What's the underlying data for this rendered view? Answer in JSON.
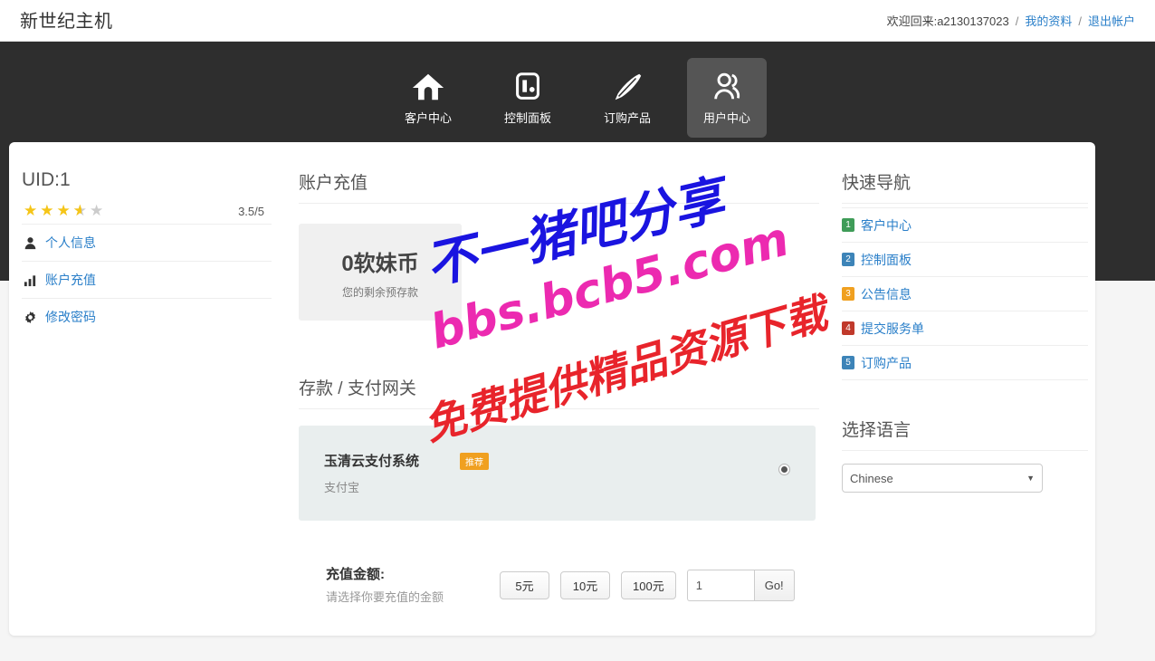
{
  "header": {
    "brand": "新世纪主机",
    "welcome_prefix": "欢迎回来:",
    "username": "a2130137023",
    "sep": "/",
    "profile_link": "我的资料",
    "logout_link": "退出帐户"
  },
  "nav": {
    "items": [
      {
        "label": "客户中心",
        "icon": "home-icon",
        "active": false
      },
      {
        "label": "控制面板",
        "icon": "control-panel-icon",
        "active": false
      },
      {
        "label": "订购产品",
        "icon": "quill-pen-icon",
        "active": false
      },
      {
        "label": "用户中心",
        "icon": "users-icon",
        "active": true
      }
    ]
  },
  "sidebar": {
    "uid": "UID:1",
    "rating_value": "3.5/5",
    "rating_stars": 3.5,
    "links": [
      {
        "label": "个人信息",
        "icon": "user-icon"
      },
      {
        "label": "账户充值",
        "icon": "bar-chart-icon"
      },
      {
        "label": "修改密码",
        "icon": "gear-icon"
      }
    ]
  },
  "main": {
    "title": "账户充值",
    "balance": {
      "amount": "0软妹币",
      "caption": "您的剩余预存款"
    },
    "gateway_title": "存款 / 支付网关",
    "gateway": {
      "name": "玉清云支付系统",
      "badge": "推荐",
      "sub": "支付宝",
      "selected": true
    },
    "amount": {
      "label": "充值金额:",
      "hint": "请选择你要充值的金额",
      "presets": [
        "5元",
        "10元",
        "100元"
      ],
      "custom_value": "1",
      "go_label": "Go!"
    }
  },
  "right": {
    "quick_nav_title": "快速导航",
    "quick_items": [
      {
        "num": "1",
        "label": "客户中心",
        "color": "#3f9c58"
      },
      {
        "num": "2",
        "label": "控制面板",
        "color": "#3d84b8"
      },
      {
        "num": "3",
        "label": "公告信息",
        "color": "#f0a020"
      },
      {
        "num": "4",
        "label": "提交服务单",
        "color": "#c0392b"
      },
      {
        "num": "5",
        "label": "订购产品",
        "color": "#3d84b8"
      }
    ],
    "lang_title": "选择语言",
    "lang_selected": "Chinese"
  },
  "watermarks": {
    "blue": "不一猪吧分享",
    "pink": "bbs.bcb5.com",
    "red": "免费提供精品资源下载"
  }
}
